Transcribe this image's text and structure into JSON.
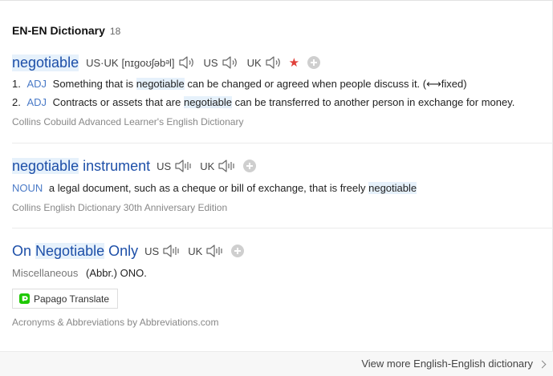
{
  "header": {
    "title": "EN-EN Dictionary",
    "count": "18"
  },
  "entries": [
    {
      "headword": "negotiable",
      "pron": {
        "us_uk_label": "US·UK",
        "phonetic": "[nɪɡoʊʃəbᵊl]",
        "us_label": "US",
        "uk_label": "UK"
      },
      "definitions": [
        {
          "num": "1.",
          "pos": "ADJ",
          "pre": "Something that is",
          "hl": "negotiable",
          "post": "can be changed or agreed when people discuss it. (⟷fixed)"
        },
        {
          "num": "2.",
          "pos": "ADJ",
          "pre": "Contracts or assets that are",
          "hl": "negotiable",
          "post": "can be transferred to another person in exchange for money."
        }
      ],
      "source": "Collins Cobuild Advanced Learner's English Dictionary"
    },
    {
      "headword_hl": "negotiable",
      "headword_rest": "instrument",
      "pron": {
        "us_label": "US",
        "uk_label": "UK"
      },
      "definition": {
        "pos": "NOUN",
        "pre": "a legal document, such as a cheque or bill of exchange, that is freely",
        "hl": "negotiable"
      },
      "source": "Collins English Dictionary 30th Anniversary Edition"
    },
    {
      "headword_pre": "On",
      "headword_hl": "Negotiable",
      "headword_post": "Only",
      "pron": {
        "us_label": "US",
        "uk_label": "UK"
      },
      "category": "Miscellaneous",
      "definition": "(Abbr.) ONO.",
      "translate_button": "Papago Translate",
      "source": "Acronyms & Abbreviations by Abbreviations.com"
    }
  ],
  "footer": {
    "view_more": "View more English-English dictionary"
  },
  "colors": {
    "headword": "#1d4fa8",
    "pos": "#4a7ac7",
    "highlight": "#e6f1fb",
    "star": "#e0403a",
    "papago": "#1ec800"
  },
  "icons": {
    "speaker": "speaker-icon",
    "star": "star-icon",
    "add": "plus-icon",
    "chevron": "chevron-right-icon",
    "papago": "papago-icon"
  }
}
